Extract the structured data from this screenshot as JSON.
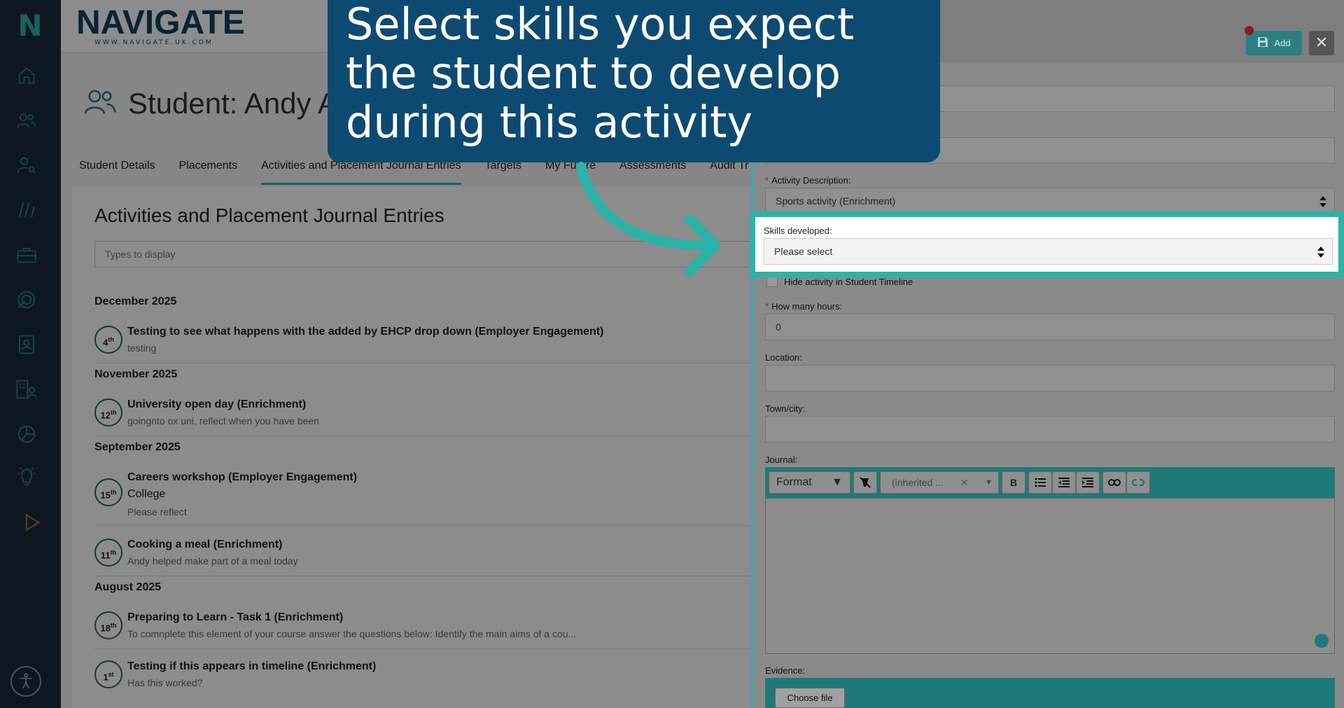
{
  "sidebar": {
    "logo": "N",
    "icons": [
      "home-icon",
      "users-icon",
      "user-search-icon",
      "slashes-icon",
      "briefcase-icon",
      "target-icon",
      "contact-card-icon",
      "building-users-icon",
      "pie-chart-icon",
      "lightbulb-icon",
      "play-icon",
      "accessibility-icon"
    ]
  },
  "brand": {
    "name": "NAVIGATE",
    "url": "WWW.NAVIGATE.UK.COM"
  },
  "student": {
    "title": "Student: Andy A"
  },
  "tabs": [
    "Student Details",
    "Placements",
    "Activities and Placement Journal Entries",
    "Targets",
    "My Future",
    "Assessments",
    "Audit Tr"
  ],
  "content": {
    "title": "Activities and Placement Journal Entries",
    "types_placeholder": "Types to display",
    "groups": [
      {
        "month": "December 2025",
        "entries": [
          {
            "day": "4",
            "suffix": "th",
            "title": "Testing to see what happens with the added by EHCP drop down (Employer Engagement)",
            "sub": "testing"
          }
        ]
      },
      {
        "month": "November 2025",
        "entries": [
          {
            "day": "12",
            "suffix": "th",
            "title": "University open day (Enrichment)",
            "sub": "goingnto ox uni, reflect when you have been"
          }
        ]
      },
      {
        "month": "September 2025",
        "entries": [
          {
            "day": "15",
            "suffix": "th",
            "title": "Careers workshop (Employer Engagement)",
            "extra": "College",
            "sub": "Please reflect"
          },
          {
            "day": "11",
            "suffix": "th",
            "title": "Cooking a meal (Enrichment)",
            "sub": "Andy helped make part of a meal today"
          }
        ]
      },
      {
        "month": "August 2025",
        "entries": [
          {
            "day": "18",
            "suffix": "th",
            "title": "Preparing to Learn - Task 1 (Enrichment)",
            "sub": "To comnplete this element of your course answer the questions below: Identify the main aims of a cou..."
          },
          {
            "day": "1",
            "suffix": "st",
            "title": "Testing if this appears in timeline (Enrichment)",
            "sub": "Has this worked?"
          }
        ]
      }
    ]
  },
  "panel": {
    "add_label": "Add",
    "close_label": "✕",
    "activity_description": {
      "label": "Activity Description:",
      "value": "Sports activity (Enrichment)"
    },
    "skills": {
      "label": "Skills developed:",
      "value": "Please select"
    },
    "hide_timeline": "Hide activity in Student Timeline",
    "hours": {
      "label": "How many hours:",
      "value": "0"
    },
    "location": {
      "label": "Location:",
      "value": ""
    },
    "town": {
      "label": "Town/city:",
      "value": ""
    },
    "journal": {
      "label": "Journal:",
      "format": "Format",
      "font": "(inherited ...",
      "clear": "✕",
      "bold": "B"
    },
    "evidence": {
      "label": "Evidence:",
      "choose_file": "Choose file"
    }
  },
  "callout": {
    "text": "Select skills you expect the student to develop during this activity"
  },
  "colors": {
    "accent": "#2ab3a6",
    "callout_bg": "#0d4a72",
    "sidebar_bg": "#1a2b3a"
  }
}
